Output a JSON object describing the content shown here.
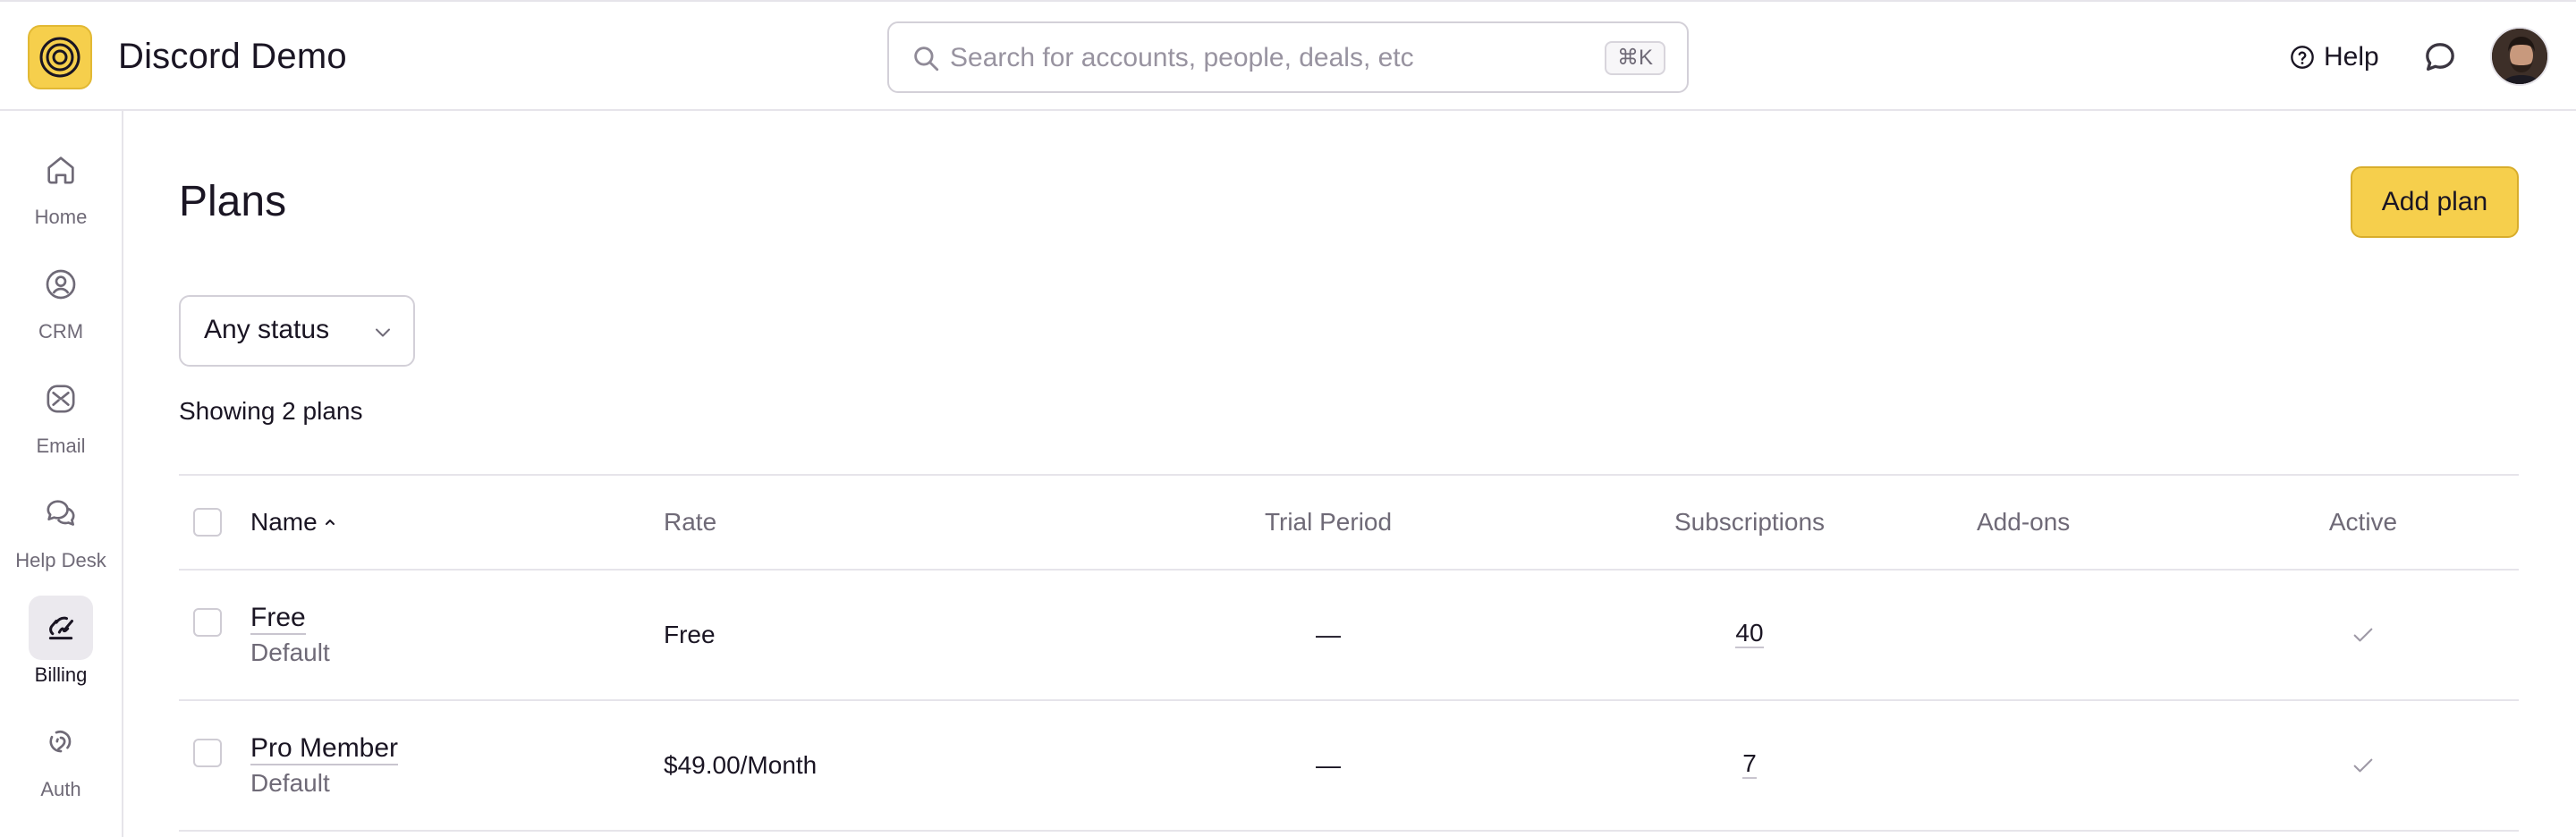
{
  "app": {
    "title": "Discord Demo",
    "logo_icon": "spiral-logo-icon",
    "brand_color": "#f6cf4c"
  },
  "header": {
    "search_placeholder": "Search for accounts, people, deals, etc",
    "search_shortcut": "⌘K",
    "help_label": "Help"
  },
  "sidebar": {
    "items": [
      {
        "label": "Home",
        "icon": "home-icon",
        "active": false
      },
      {
        "label": "CRM",
        "icon": "contact-icon",
        "active": false
      },
      {
        "label": "Email",
        "icon": "email-icon",
        "active": false
      },
      {
        "label": "Help Desk",
        "icon": "chat-bubbles-icon",
        "active": false
      },
      {
        "label": "Billing",
        "icon": "billing-icon",
        "active": true
      },
      {
        "label": "Auth",
        "icon": "auth-icon",
        "active": false
      }
    ]
  },
  "page": {
    "title": "Plans",
    "add_button_label": "Add plan",
    "status_filter": "Any status",
    "count_text": "Showing 2 plans"
  },
  "table": {
    "columns": [
      "Name",
      "Rate",
      "Trial Period",
      "Subscriptions",
      "Add-ons",
      "Active"
    ],
    "rows": [
      {
        "name": "Free",
        "sub": "Default",
        "rate": "Free",
        "trial": "—",
        "subscriptions": "40",
        "addons": "",
        "active": true
      },
      {
        "name": "Pro Member",
        "sub": "Default",
        "rate": "$49.00/Month",
        "trial": "—",
        "subscriptions": "7",
        "addons": "",
        "active": true
      }
    ]
  }
}
